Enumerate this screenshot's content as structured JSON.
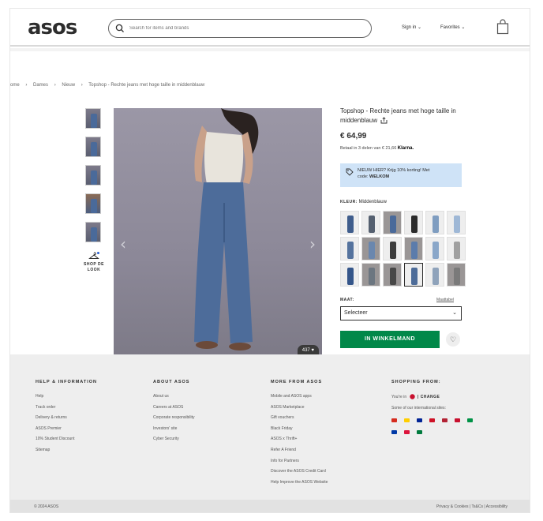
{
  "header": {
    "logo": "asos",
    "search_placeholder": "Search for items and brands",
    "sign_in": "Sign in ⌄",
    "favorites": "Favorites ⌄"
  },
  "breadcrumb": [
    "ome",
    "›",
    "Dames",
    "›",
    "Nieuw",
    "›",
    "Topshop - Rechte jeans met hoge taille in middenblauw"
  ],
  "thumbnails": {
    "shop_look_line1": "SHOP DE",
    "shop_look_line2": "LOOK"
  },
  "image": {
    "likes": "437 ♥",
    "prev": "‹",
    "next": "›"
  },
  "product": {
    "name": "Topshop - Rechte jeans met hoge taille in middenblauw",
    "price": "€ 64,99",
    "klarna_text": "Betaal in 3 delen van € 21,66",
    "klarna_brand": "Klarna.",
    "promo_line1": "NIEUW HIER? Krijg 10% korting! Met",
    "promo_code_label": "code:",
    "promo_code": "WELKOM",
    "color_label": "KLEUR:",
    "color_value": "Middenblauw",
    "size_label": "MAAT:",
    "size_guide": "Maattabel",
    "size_select": "Selecteer",
    "add_to_cart": "IN WINKELMAND"
  },
  "swatch_colors": [
    "#3f5d8c",
    "#556070",
    "#4a6a9a",
    "#2b2b2b",
    "#7f9dc0",
    "#9fb8d6",
    "#55739e",
    "#6a87ae",
    "#3d3d3d",
    "#5c7cab",
    "#8aa7c9",
    "#a0a0a0",
    "#35568a",
    "#6c7680",
    "#474747",
    "#4d6c99",
    "#8fa3bb",
    "#7a7a7a"
  ],
  "footer": {
    "help": {
      "heading": "HELP & INFORMATION",
      "links": [
        "Help",
        "Track order",
        "Delivery & returns",
        "ASOS Premier",
        "10% Student Discount",
        "Sitemap"
      ]
    },
    "about": {
      "heading": "ABOUT ASOS",
      "links": [
        "About us",
        "Careers at ASOS",
        "Corporate responsibility",
        "Investors' site",
        "Cyber Security"
      ]
    },
    "more": {
      "heading": "MORE FROM ASOS",
      "links": [
        "Mobile and ASOS apps",
        "ASOS Marketplace",
        "Gift vouchers",
        "Black Friday",
        "ASOS x Thrift+",
        "Refer A Friend",
        "Info for Partners",
        "Discover the ASOS Credit Card",
        "Help Improve the ASOS Website"
      ]
    },
    "shopping": {
      "heading": "SHOPPING FROM:",
      "youre_in": "You're in",
      "change": "| CHANGE",
      "intl": "Some of our international sites:"
    },
    "flag_colors": [
      "#d52b1e",
      "#ffce00",
      "#002395",
      "#ce1126",
      "#b22234",
      "#c8102e",
      "#009246",
      "#0039a6",
      "#dc143c",
      "#007a3d"
    ],
    "copyright": "© 2024 ASOS",
    "legal": "Privacy & Cookies  |  Ts&Cs  |  Accessibility"
  }
}
